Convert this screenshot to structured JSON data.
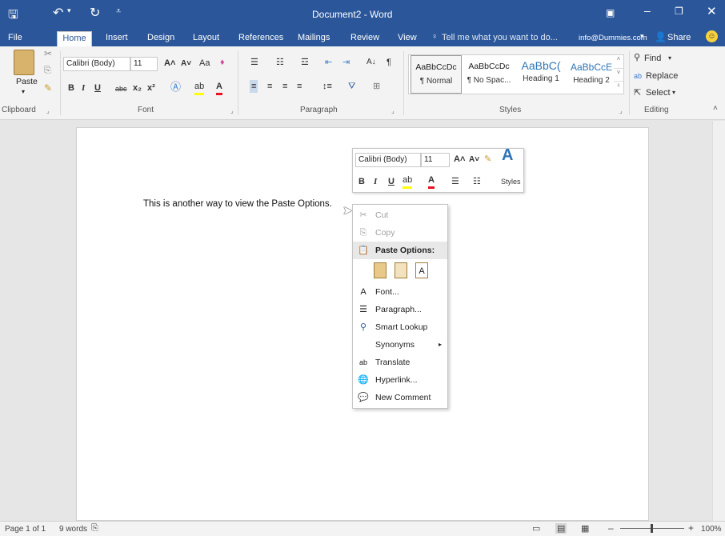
{
  "titlebar": {
    "title": "Document2 - Word",
    "tell_me": "Tell me what you want to do...",
    "account": "info@Dummies.com",
    "share": "Share"
  },
  "tabs": [
    "File",
    "Home",
    "Insert",
    "Design",
    "Layout",
    "References",
    "Mailings",
    "Review",
    "View"
  ],
  "ribbon": {
    "clipboard": {
      "label": "Clipboard",
      "paste": "Paste"
    },
    "font": {
      "label": "Font",
      "family": "Calibri (Body)",
      "size": "11",
      "case": "Aa"
    },
    "paragraph": {
      "label": "Paragraph"
    },
    "styles": {
      "label": "Styles",
      "items": [
        {
          "preview": "AaBbCcDc",
          "name": "¶ Normal"
        },
        {
          "preview": "AaBbCcDc",
          "name": "¶ No Spac..."
        },
        {
          "preview": "AaBbC(",
          "name": "Heading 1"
        },
        {
          "preview": "AaBbCcE",
          "name": "Heading 2"
        }
      ]
    },
    "editing": {
      "label": "Editing",
      "find": "Find",
      "replace": "Replace",
      "select": "Select"
    }
  },
  "document": {
    "text": "This is another way to view the Paste Options."
  },
  "mini_toolbar": {
    "font": "Calibri (Body)",
    "size": "11",
    "styles": "Styles"
  },
  "context_menu": {
    "cut": "Cut",
    "copy": "Copy",
    "paste_options": "Paste Options:",
    "font": "Font...",
    "paragraph": "Paragraph...",
    "smart_lookup": "Smart Lookup",
    "synonyms": "Synonyms",
    "translate": "Translate",
    "hyperlink": "Hyperlink...",
    "new_comment": "New Comment"
  },
  "statusbar": {
    "page": "Page 1 of 1",
    "words": "9 words",
    "zoom": "100%"
  },
  "colors": {
    "brand": "#2b579a",
    "highlight": "#ffff00",
    "font_color": "#e81123"
  }
}
